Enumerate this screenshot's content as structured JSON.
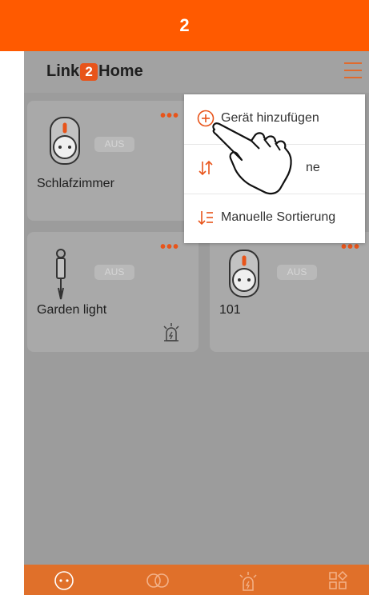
{
  "step": {
    "number": "2"
  },
  "app": {
    "logo_prefix": "Link",
    "logo_two": "2",
    "logo_suffix": "Home"
  },
  "devices": [
    {
      "name": "Schlafzimmer",
      "status": "AUS"
    },
    {
      "name": "Garden light",
      "status": "AUS"
    },
    {
      "name": "101",
      "status": "AUS"
    }
  ],
  "menu": {
    "items": [
      {
        "label": "Gerät hinzufügen",
        "icon": "plus-circle-icon"
      },
      {
        "label": "ne",
        "icon": "sort-icon"
      },
      {
        "label": "Manuelle Sortierung",
        "icon": "manual-sort-icon"
      }
    ]
  },
  "bottom_nav": {
    "items": [
      {
        "icon": "socket-icon"
      },
      {
        "icon": "link-icon"
      },
      {
        "icon": "alarm-light-icon"
      },
      {
        "icon": "apps-grid-icon"
      }
    ]
  },
  "colors": {
    "accent": "#ff5a00",
    "nav": "#e0702a",
    "background": "#9c9c9c"
  }
}
